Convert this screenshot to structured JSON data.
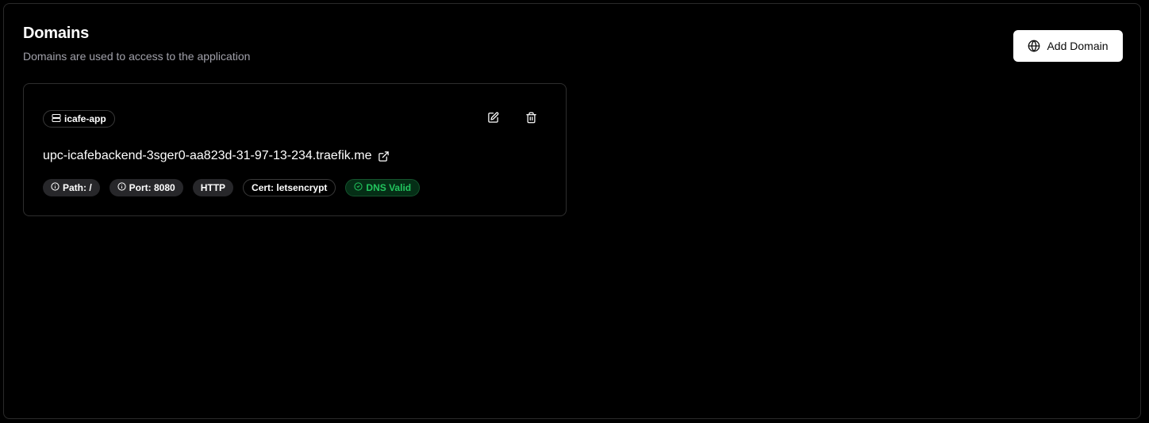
{
  "header": {
    "title": "Domains",
    "subtitle": "Domains are used to access to the application",
    "add_button_label": "Add Domain",
    "add_button_icon": "globe-icon"
  },
  "domains": [
    {
      "service": "icafe-app",
      "service_icon": "server-icon",
      "host": "upc-icafebackend-3sger0-aa823d-31-97-13-234.traefik.me",
      "tags": {
        "path": "Path: /",
        "port": "Port: 8080",
        "protocol": "HTTP",
        "cert": "Cert: letsencrypt",
        "dns": "DNS Valid"
      },
      "dns_status_color": "#22c55e"
    }
  ],
  "colors": {
    "background": "#000000",
    "border": "#2e2e2e",
    "muted_text": "#a1a1aa",
    "primary_button": "#ffffff",
    "success": "#22c55e"
  }
}
